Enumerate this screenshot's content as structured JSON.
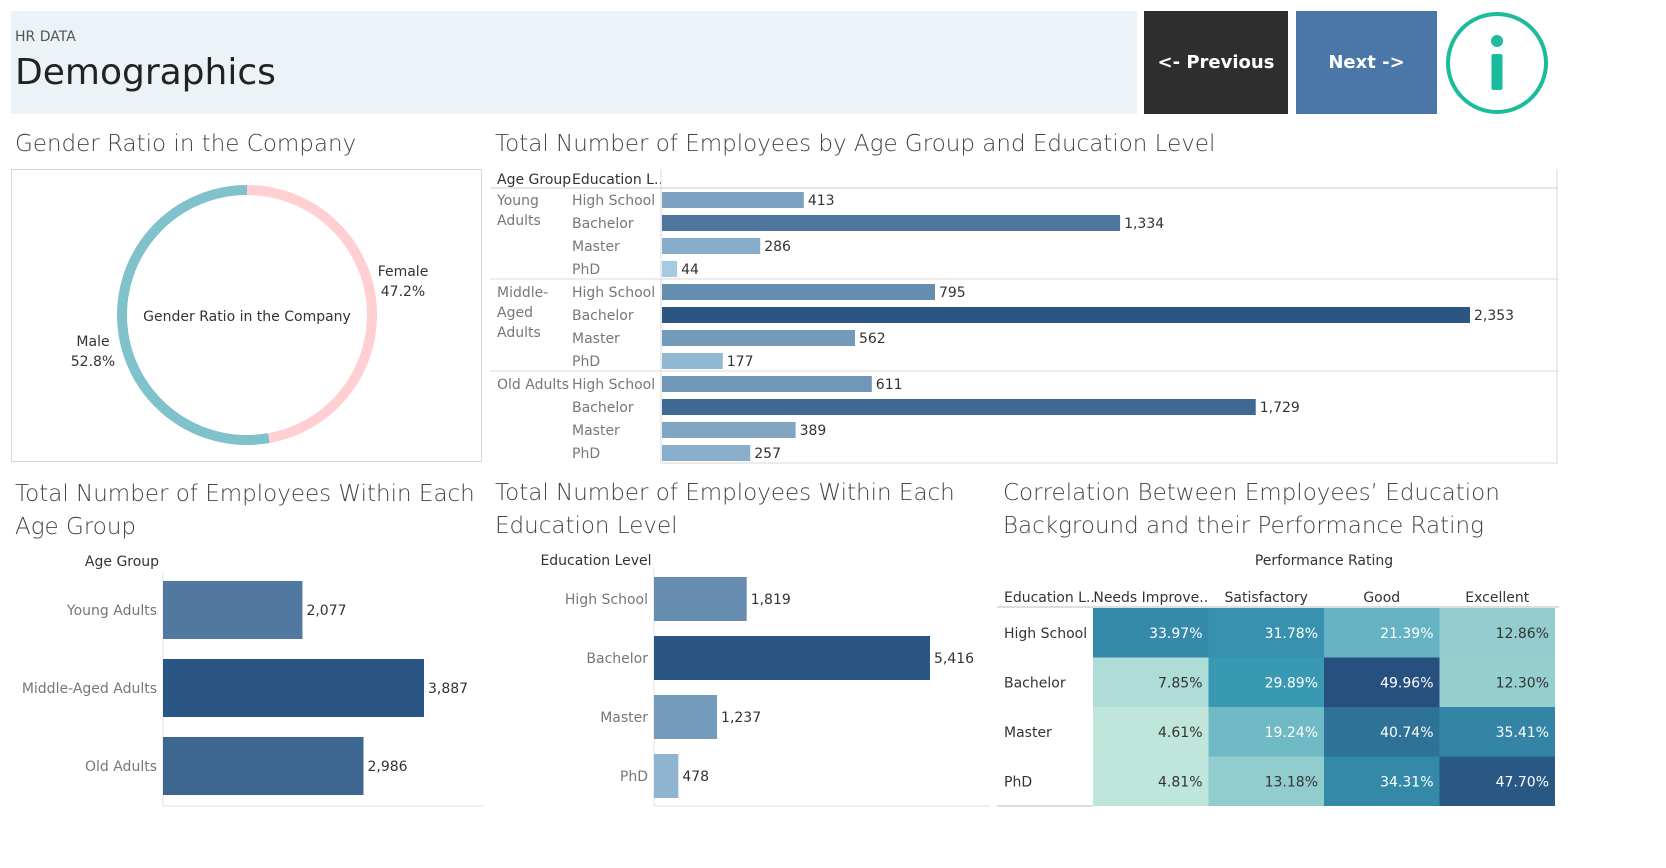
{
  "header": {
    "subtitle": "HR DATA",
    "title": "Demographics",
    "prev_label": "<- Previous",
    "next_label": "Next ->",
    "info_icon": "info-icon",
    "accent": "#1abc9c"
  },
  "gender_chart": {
    "title": "Gender Ratio in the Company",
    "center_label": "Gender Ratio in the Company",
    "chart_data": {
      "type": "pie",
      "title": "Gender Ratio in the Company",
      "slices": [
        {
          "name": "Female",
          "value": 47.2,
          "label": "47.2%",
          "color": "#ffcfd2"
        },
        {
          "name": "Male",
          "value": 52.8,
          "label": "52.8%",
          "color": "#80c2cc"
        }
      ]
    }
  },
  "age_edu_chart": {
    "title": "Total Number of Employees by Age Group and Education Level",
    "col_age": "Age Group",
    "col_edu": "Education L..",
    "chart_data": {
      "type": "bar",
      "title": "Total Number of Employees by Age Group and Education Level",
      "groups": [
        {
          "name": "Young Adults",
          "label_lines": [
            "Young",
            "Adults"
          ],
          "rows": [
            {
              "category": "High School",
              "value": 413,
              "label": "413"
            },
            {
              "category": "Bachelor",
              "value": 1334,
              "label": "1,334"
            },
            {
              "category": "Master",
              "value": 286,
              "label": "286"
            },
            {
              "category": "PhD",
              "value": 44,
              "label": "44"
            }
          ]
        },
        {
          "name": "Middle-Aged Adults",
          "label_lines": [
            "Middle-",
            "Aged",
            "Adults"
          ],
          "rows": [
            {
              "category": "High School",
              "value": 795,
              "label": "795"
            },
            {
              "category": "Bachelor",
              "value": 2353,
              "label": "2,353"
            },
            {
              "category": "Master",
              "value": 562,
              "label": "562"
            },
            {
              "category": "PhD",
              "value": 177,
              "label": "177"
            }
          ]
        },
        {
          "name": "Old Adults",
          "label_lines": [
            "Old Adults"
          ],
          "rows": [
            {
              "category": "High School",
              "value": 611,
              "label": "611"
            },
            {
              "category": "Bachelor",
              "value": 1729,
              "label": "1,729"
            },
            {
              "category": "Master",
              "value": 389,
              "label": "389"
            },
            {
              "category": "PhD",
              "value": 257,
              "label": "257"
            }
          ]
        }
      ],
      "xlim": [
        0,
        2353
      ]
    }
  },
  "age_group_chart": {
    "title_lines": [
      "Total Number of Employees Within Each",
      "Age Group"
    ],
    "header": "Age Group",
    "chart_data": {
      "type": "bar",
      "categories": [
        "Young Adults",
        "Middle-Aged Adults",
        "Old Adults"
      ],
      "values": [
        2077,
        3887,
        2986
      ],
      "labels": [
        "2,077",
        "3,887",
        "2,986"
      ],
      "xlim": [
        0,
        3887
      ]
    }
  },
  "edu_chart": {
    "title_lines": [
      "Total Number of Employees Within Each",
      "Education Level"
    ],
    "header": "Education Level",
    "chart_data": {
      "type": "bar",
      "categories": [
        "High School",
        "Bachelor",
        "Master",
        "PhD"
      ],
      "values": [
        1819,
        5416,
        1237,
        478
      ],
      "labels": [
        "1,819",
        "5,416",
        "1,237",
        "478"
      ],
      "xlim": [
        0,
        5416
      ]
    }
  },
  "heatmap_chart": {
    "title_lines": [
      "Correlation Between Employees’ Education",
      "Background and their Performance Rating"
    ],
    "top_header": "Performance Rating",
    "row_header": "Education L..",
    "chart_data": {
      "type": "heatmap",
      "columns": [
        "Needs Improve..",
        "Satisfactory",
        "Good",
        "Excellent"
      ],
      "rows": [
        "High School",
        "Bachelor",
        "Master",
        "PhD"
      ],
      "values": [
        [
          33.97,
          31.78,
          21.39,
          12.86
        ],
        [
          7.85,
          29.89,
          49.96,
          12.3
        ],
        [
          4.61,
          19.24,
          40.74,
          35.41
        ],
        [
          4.81,
          13.18,
          34.31,
          47.7
        ]
      ],
      "labels": [
        [
          "33.97%",
          "31.78%",
          "21.39%",
          "12.86%"
        ],
        [
          "7.85%",
          "29.89%",
          "49.96%",
          "12.30%"
        ],
        [
          "4.61%",
          "19.24%",
          "40.74%",
          "35.41%"
        ],
        [
          "4.81%",
          "13.18%",
          "34.31%",
          "47.70%"
        ]
      ]
    }
  }
}
